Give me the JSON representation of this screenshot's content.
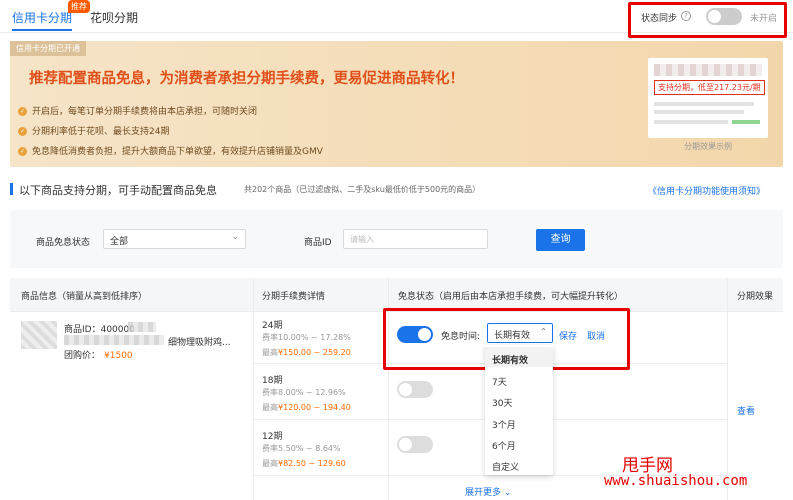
{
  "tabs": {
    "credit": "信用卡分期",
    "badge": "推荐",
    "huabei": "花呗分期"
  },
  "sync": {
    "label": "状态同步",
    "help": "?",
    "status": "未开启"
  },
  "banner": {
    "tag": "信用卡分期已开通",
    "title": "推荐配置商品免息，为消费者承担分期手续费，更易促进商品转化！",
    "benefits": [
      "开启后，每笔订单分期手续费将由本店承担，可随时关闭",
      "分期利率低于花呗、最长支持24期",
      "免息降低消费者负担，提升大额商品下单欲望，有效提升店铺销量及GMV"
    ],
    "preview_promo": "支持分期，低至217.23元/期",
    "preview_caption": "分期效果示例"
  },
  "section": {
    "title": "以下商品支持分期，可手动配置商品免息",
    "subtitle": "共202个商品（已过滤虚拟、二手及sku最低价低于500元的商品）",
    "link": "《信用卡分期功能使用须知》"
  },
  "filter": {
    "status_label": "商品免息状态",
    "status_value": "全部",
    "id_label": "商品ID",
    "id_placeholder": "请输入",
    "search": "查询"
  },
  "table": {
    "headers": [
      "商品信息（销量从高到低排序）",
      "分期手续费详情",
      "免息状态（启用后由本店承担手续费，可大幅提升转化）",
      "分期效果"
    ],
    "product": {
      "id_label": "商品ID：",
      "id_value": "400000",
      "name_tail": "细物理吸附鸡...",
      "price_label": "团购价：",
      "price": "¥1500"
    },
    "plans": [
      {
        "period": "24期",
        "rate": "费率10.00% ~ 17.28%",
        "max_label": "最高",
        "max_value": "¥150.00 ~ 259.20"
      },
      {
        "period": "18期",
        "rate": "费率8.00% ~ 12.96%",
        "max_label": "最高",
        "max_value": "¥120.00 ~ 194.40"
      },
      {
        "period": "12期",
        "rate": "费率5.50% ~ 8.64%",
        "max_label": "最高",
        "max_value": "¥82.50 ~ 129.60"
      }
    ],
    "free_time_label": "免息时间:",
    "free_time_value": "长期有效",
    "save": "保存",
    "cancel": "取消",
    "options": [
      "长期有效",
      "7天",
      "30天",
      "3个月",
      "6个月",
      "自定义"
    ],
    "view": "查看",
    "more": "展开更多"
  },
  "watermark": {
    "cn": "甩手网",
    "url": "www.shuaishou.com"
  },
  "colors": {
    "primary": "#1a73e8",
    "accent": "#ff6a00",
    "highlight": "#e60000"
  }
}
